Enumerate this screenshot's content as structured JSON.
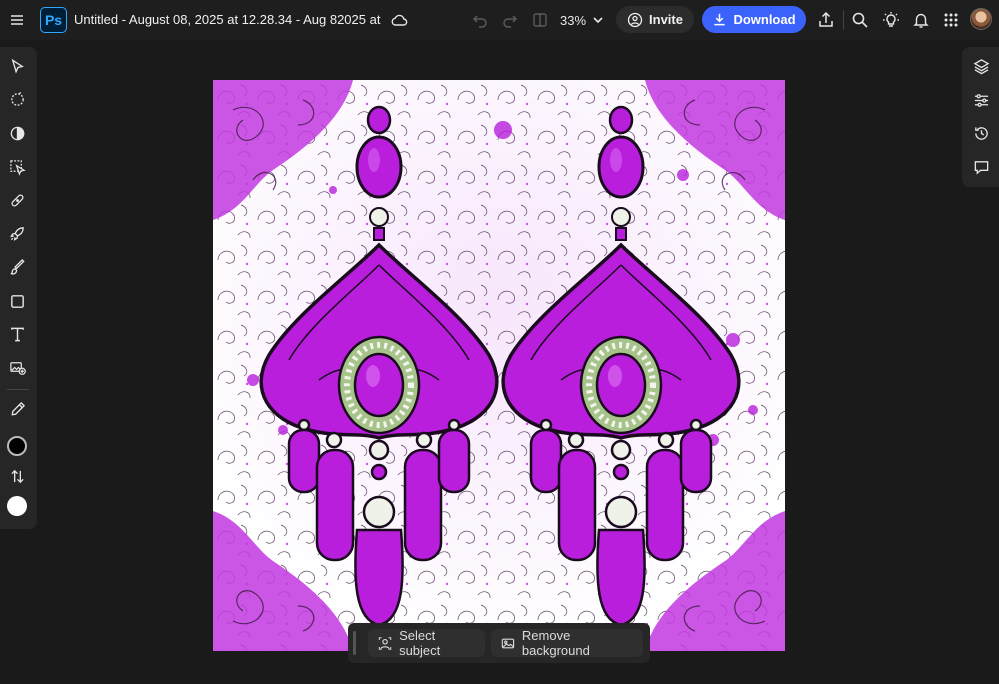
{
  "header": {
    "app_logo": "Ps",
    "doc_title": "Untitled - August 08, 2025 at 12.28.34 - Aug 82025 at ...",
    "zoom": "33%",
    "invite_label": "Invite",
    "download_label": "Download",
    "icons": [
      "menu-icon",
      "cloud-icon",
      "undo-icon",
      "redo-icon",
      "compare-icon",
      "share-icon",
      "search-icon",
      "lightbulb-icon",
      "bell-icon",
      "apps-grid-icon"
    ]
  },
  "left_toolbar": {
    "tools": [
      "select-tool",
      "quick-select-tool",
      "adjust-tool",
      "object-select-tool",
      "healing-tool",
      "generative-fill-tool",
      "brush-tool",
      "shape-tool",
      "text-tool",
      "add-image-tool",
      "eyedropper-tool"
    ],
    "foreground_color": "#000000",
    "background_color": "#ffffff"
  },
  "right_panel": {
    "tools": [
      "layers-icon",
      "adjustments-icon",
      "history-icon",
      "comments-icon"
    ]
  },
  "contextual_bar": {
    "select_subject_label": "Select subject",
    "remove_background_label": "Remove background"
  },
  "colors": {
    "accent": "#3b63fb",
    "brand": "#31a8ff",
    "canvas_magenta": "#b81edc"
  }
}
